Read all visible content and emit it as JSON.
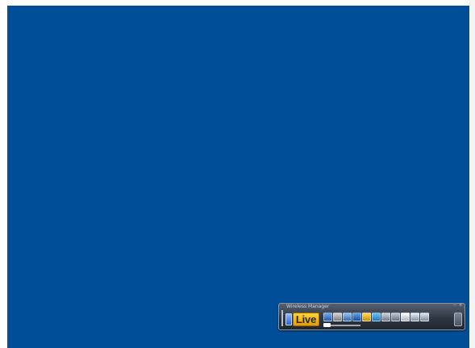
{
  "desktop": {
    "background_color": "#004e98",
    "window_frame_color": "#ffffff"
  },
  "wireless_manager": {
    "title": "Wireless Manager",
    "live_label": "Live",
    "minimize_icon": "minimize-icon",
    "close_icon": "close-icon",
    "phone_icon": "phone-icon",
    "icons": [
      {
        "name": "bluetooth-icon"
      },
      {
        "name": "network-settings-icon"
      },
      {
        "name": "display-icon"
      },
      {
        "name": "mail-icon"
      },
      {
        "name": "folder-icon"
      },
      {
        "name": "screen-icon"
      },
      {
        "name": "globe-icon"
      },
      {
        "name": "users-icon"
      },
      {
        "name": "camera-icon"
      },
      {
        "name": "video-icon"
      },
      {
        "name": "expand-icon"
      }
    ],
    "slider_icon": "volume-slider",
    "accent_color": "#f5b400"
  }
}
